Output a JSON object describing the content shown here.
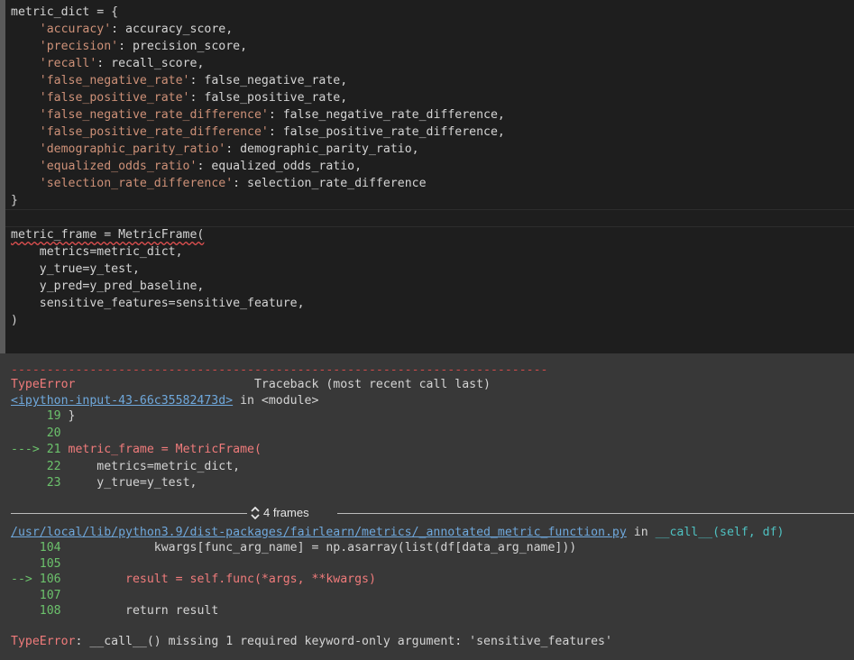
{
  "code_cell": {
    "lines": [
      {
        "segments": [
          {
            "t": "metric_dict = {",
            "c": ""
          }
        ]
      },
      {
        "segments": [
          {
            "t": "    ",
            "c": ""
          },
          {
            "t": "'accuracy'",
            "c": "str"
          },
          {
            "t": ": accuracy_score,",
            "c": ""
          }
        ]
      },
      {
        "segments": [
          {
            "t": "    ",
            "c": ""
          },
          {
            "t": "'precision'",
            "c": "str"
          },
          {
            "t": ": precision_score,",
            "c": ""
          }
        ]
      },
      {
        "segments": [
          {
            "t": "    ",
            "c": ""
          },
          {
            "t": "'recall'",
            "c": "str"
          },
          {
            "t": ": recall_score,",
            "c": ""
          }
        ]
      },
      {
        "segments": [
          {
            "t": "    ",
            "c": ""
          },
          {
            "t": "'false_negative_rate'",
            "c": "str"
          },
          {
            "t": ": false_negative_rate,",
            "c": ""
          }
        ]
      },
      {
        "segments": [
          {
            "t": "    ",
            "c": ""
          },
          {
            "t": "'false_positive_rate'",
            "c": "str"
          },
          {
            "t": ": false_positive_rate,",
            "c": ""
          }
        ]
      },
      {
        "segments": [
          {
            "t": "    ",
            "c": ""
          },
          {
            "t": "'false_negative_rate_difference'",
            "c": "str"
          },
          {
            "t": ": false_negative_rate_difference,",
            "c": ""
          }
        ]
      },
      {
        "segments": [
          {
            "t": "    ",
            "c": ""
          },
          {
            "t": "'false_positive_rate_difference'",
            "c": "str"
          },
          {
            "t": ": false_positive_rate_difference,",
            "c": ""
          }
        ]
      },
      {
        "segments": [
          {
            "t": "    ",
            "c": ""
          },
          {
            "t": "'demographic_parity_ratio'",
            "c": "str"
          },
          {
            "t": ": demographic_parity_ratio,",
            "c": ""
          }
        ]
      },
      {
        "segments": [
          {
            "t": "    ",
            "c": ""
          },
          {
            "t": "'equalized_odds_ratio'",
            "c": "str"
          },
          {
            "t": ": equalized_odds_ratio,",
            "c": ""
          }
        ]
      },
      {
        "segments": [
          {
            "t": "    ",
            "c": ""
          },
          {
            "t": "'selection_rate_difference'",
            "c": "str"
          },
          {
            "t": ": selection_rate_difference",
            "c": ""
          }
        ]
      },
      {
        "segments": [
          {
            "t": "}",
            "c": ""
          }
        ]
      },
      {
        "segments": [
          {
            "t": "",
            "c": ""
          }
        ]
      },
      {
        "segments": [
          {
            "t": "metric_frame = MetricFrame(",
            "c": "squiggle"
          }
        ]
      },
      {
        "segments": [
          {
            "t": "    metrics=metric_dict,",
            "c": ""
          }
        ]
      },
      {
        "segments": [
          {
            "t": "    y_true=y_test,",
            "c": ""
          }
        ]
      },
      {
        "segments": [
          {
            "t": "    y_pred=y_pred_baseline,",
            "c": ""
          }
        ]
      },
      {
        "segments": [
          {
            "t": "    sensitive_features=sensitive_feature,",
            "c": ""
          }
        ]
      },
      {
        "segments": [
          {
            "t": ")",
            "c": ""
          }
        ]
      }
    ]
  },
  "traceback": {
    "dashes": "---------------------------------------------------------------------------",
    "error_name": "TypeError",
    "header": "                         Traceback (most recent call last)",
    "input_link": "<ipython-input-43-66c35582473d>",
    "in_module": " in <module>",
    "frame1_lines": [
      {
        "prefix": "     ",
        "num": "19",
        "code": " }",
        "arrow": false
      },
      {
        "prefix": "     ",
        "num": "20",
        "code": "",
        "arrow": false
      },
      {
        "prefix": "---> ",
        "num": "21",
        "code": " metric_frame = MetricFrame(",
        "arrow": true
      },
      {
        "prefix": "     ",
        "num": "22",
        "code": "     metrics=metric_dict,",
        "arrow": false
      },
      {
        "prefix": "     ",
        "num": "23",
        "code": "     y_true=y_test,",
        "arrow": false
      }
    ],
    "frames_label": "4 frames",
    "file_link": "/usr/local/lib/python3.9/dist-packages/fairlearn/metrics/_annotated_metric_function.py",
    "file_in": " in ",
    "file_func": "__call__(self, df)",
    "frame2_lines": [
      {
        "prefix": "    ",
        "num": "104",
        "code": "             kwargs[func_arg_name] = np.asarray(list(df[data_arg_name]))",
        "arrow": false
      },
      {
        "prefix": "    ",
        "num": "105",
        "code": "",
        "arrow": false
      },
      {
        "prefix": "--> ",
        "num": "106",
        "code": "         result = self.func(*args, **kwargs)",
        "arrow": true
      },
      {
        "prefix": "    ",
        "num": "107",
        "code": "",
        "arrow": false
      },
      {
        "prefix": "    ",
        "num": "108",
        "code": "         return result",
        "arrow": false
      }
    ],
    "final_error_name": "TypeError",
    "final_error_msg": ": __call__() missing 1 required keyword-only argument: 'sensitive_features'"
  },
  "colors": {
    "code_bg": "#1e1e1e",
    "output_bg": "#383838",
    "string": "#ce9178",
    "error": "#f07b7b",
    "line_number": "#6cc26c",
    "link": "#6fa8dc"
  }
}
